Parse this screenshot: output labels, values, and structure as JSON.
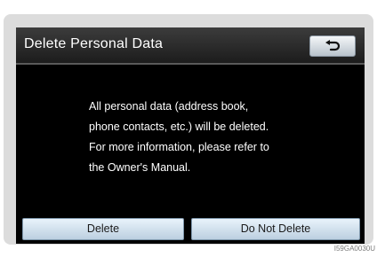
{
  "dialog": {
    "title": "Delete Personal Data",
    "back_icon": "return-arrow-icon",
    "message": "All personal data (address book,\nphone contacts, etc.) will be deleted.\nFor more information, please refer to\nthe Owner's Manual."
  },
  "actions": {
    "delete_label": "Delete",
    "do_not_delete_label": "Do Not Delete"
  },
  "image_code": "I59GA0030U",
  "colors": {
    "screen_background": "#000000",
    "title_text": "#ffffff",
    "button_face": "#cfe0ee",
    "bezel": "#dcdcdc"
  }
}
